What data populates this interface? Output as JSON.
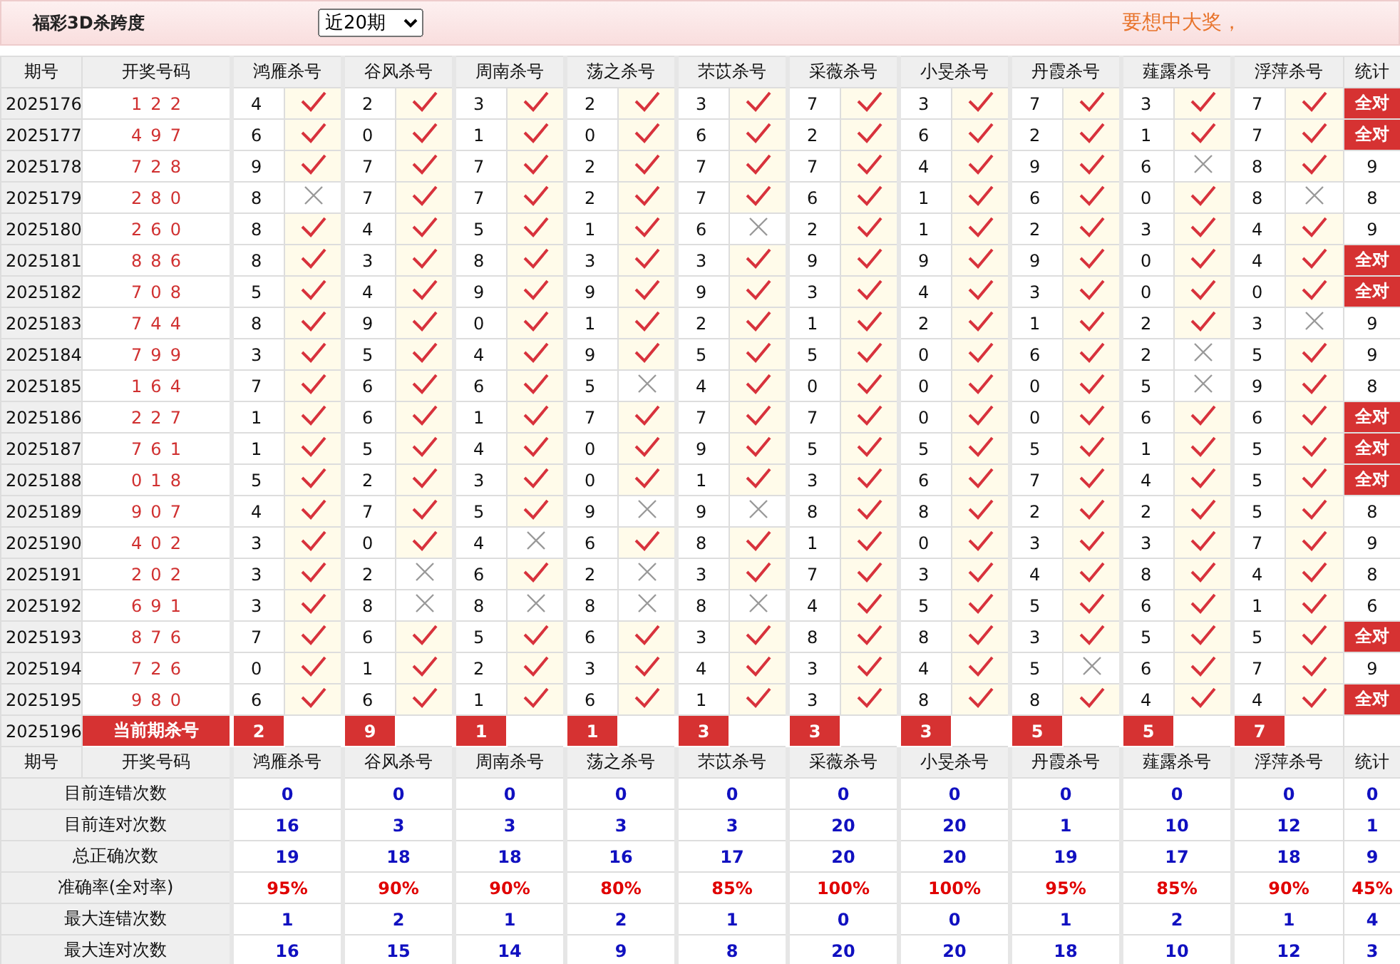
{
  "header": {
    "title": "福彩3D杀跨度",
    "period_select": "近20期",
    "slogan": "要想中大奖，"
  },
  "columns": {
    "period": "期号",
    "draw": "开奖号码",
    "predictors": [
      "鸿雁杀号",
      "谷风杀号",
      "周南杀号",
      "荡之杀号",
      "芣苡杀号",
      "采薇杀号",
      "小旻杀号",
      "丹霞杀号",
      "薤露杀号",
      "浮萍杀号"
    ],
    "stat": "统计"
  },
  "rows": [
    {
      "period": "2025176",
      "draw": "122",
      "picks": [
        "4",
        "2",
        "3",
        "2",
        "3",
        "7",
        "3",
        "7",
        "3",
        "7"
      ],
      "hits": [
        true,
        true,
        true,
        true,
        true,
        true,
        true,
        true,
        true,
        true
      ],
      "stat": "全对",
      "all_correct": true
    },
    {
      "period": "2025177",
      "draw": "497",
      "picks": [
        "6",
        "0",
        "1",
        "0",
        "6",
        "2",
        "6",
        "2",
        "1",
        "7"
      ],
      "hits": [
        true,
        true,
        true,
        true,
        true,
        true,
        true,
        true,
        true,
        true
      ],
      "stat": "全对",
      "all_correct": true
    },
    {
      "period": "2025178",
      "draw": "728",
      "picks": [
        "9",
        "7",
        "7",
        "2",
        "7",
        "7",
        "4",
        "9",
        "6",
        "8"
      ],
      "hits": [
        true,
        true,
        true,
        true,
        true,
        true,
        true,
        true,
        false,
        true
      ],
      "stat": "9",
      "all_correct": false
    },
    {
      "period": "2025179",
      "draw": "280",
      "picks": [
        "8",
        "7",
        "7",
        "2",
        "7",
        "6",
        "1",
        "6",
        "0",
        "8"
      ],
      "hits": [
        false,
        true,
        true,
        true,
        true,
        true,
        true,
        true,
        true,
        false
      ],
      "stat": "8",
      "all_correct": false
    },
    {
      "period": "2025180",
      "draw": "260",
      "picks": [
        "8",
        "4",
        "5",
        "1",
        "6",
        "2",
        "1",
        "2",
        "3",
        "4"
      ],
      "hits": [
        true,
        true,
        true,
        true,
        false,
        true,
        true,
        true,
        true,
        true
      ],
      "stat": "9",
      "all_correct": false
    },
    {
      "period": "2025181",
      "draw": "886",
      "picks": [
        "8",
        "3",
        "8",
        "3",
        "3",
        "9",
        "9",
        "9",
        "0",
        "4"
      ],
      "hits": [
        true,
        true,
        true,
        true,
        true,
        true,
        true,
        true,
        true,
        true
      ],
      "stat": "全对",
      "all_correct": true
    },
    {
      "period": "2025182",
      "draw": "708",
      "picks": [
        "5",
        "4",
        "9",
        "9",
        "9",
        "3",
        "4",
        "3",
        "0",
        "0"
      ],
      "hits": [
        true,
        true,
        true,
        true,
        true,
        true,
        true,
        true,
        true,
        true
      ],
      "stat": "全对",
      "all_correct": true
    },
    {
      "period": "2025183",
      "draw": "744",
      "picks": [
        "8",
        "9",
        "0",
        "1",
        "2",
        "1",
        "2",
        "1",
        "2",
        "3"
      ],
      "hits": [
        true,
        true,
        true,
        true,
        true,
        true,
        true,
        true,
        true,
        false
      ],
      "stat": "9",
      "all_correct": false
    },
    {
      "period": "2025184",
      "draw": "799",
      "picks": [
        "3",
        "5",
        "4",
        "9",
        "5",
        "5",
        "0",
        "6",
        "2",
        "5"
      ],
      "hits": [
        true,
        true,
        true,
        true,
        true,
        true,
        true,
        true,
        false,
        true
      ],
      "stat": "9",
      "all_correct": false
    },
    {
      "period": "2025185",
      "draw": "164",
      "picks": [
        "7",
        "6",
        "6",
        "5",
        "4",
        "0",
        "0",
        "0",
        "5",
        "9"
      ],
      "hits": [
        true,
        true,
        true,
        false,
        true,
        true,
        true,
        true,
        false,
        true
      ],
      "stat": "8",
      "all_correct": false
    },
    {
      "period": "2025186",
      "draw": "227",
      "picks": [
        "1",
        "6",
        "1",
        "7",
        "7",
        "7",
        "0",
        "0",
        "6",
        "6"
      ],
      "hits": [
        true,
        true,
        true,
        true,
        true,
        true,
        true,
        true,
        true,
        true
      ],
      "stat": "全对",
      "all_correct": true
    },
    {
      "period": "2025187",
      "draw": "761",
      "picks": [
        "1",
        "5",
        "4",
        "0",
        "9",
        "5",
        "5",
        "5",
        "1",
        "5"
      ],
      "hits": [
        true,
        true,
        true,
        true,
        true,
        true,
        true,
        true,
        true,
        true
      ],
      "stat": "全对",
      "all_correct": true
    },
    {
      "period": "2025188",
      "draw": "018",
      "picks": [
        "5",
        "2",
        "3",
        "0",
        "1",
        "3",
        "6",
        "7",
        "4",
        "5"
      ],
      "hits": [
        true,
        true,
        true,
        true,
        true,
        true,
        true,
        true,
        true,
        true
      ],
      "stat": "全对",
      "all_correct": true
    },
    {
      "period": "2025189",
      "draw": "907",
      "picks": [
        "4",
        "7",
        "5",
        "9",
        "9",
        "8",
        "8",
        "2",
        "2",
        "5"
      ],
      "hits": [
        true,
        true,
        true,
        false,
        false,
        true,
        true,
        true,
        true,
        true
      ],
      "stat": "8",
      "all_correct": false
    },
    {
      "period": "2025190",
      "draw": "402",
      "picks": [
        "3",
        "0",
        "4",
        "6",
        "8",
        "1",
        "0",
        "3",
        "3",
        "7"
      ],
      "hits": [
        true,
        true,
        false,
        true,
        true,
        true,
        true,
        true,
        true,
        true
      ],
      "stat": "9",
      "all_correct": false
    },
    {
      "period": "2025191",
      "draw": "202",
      "picks": [
        "3",
        "2",
        "6",
        "2",
        "3",
        "7",
        "3",
        "4",
        "8",
        "4"
      ],
      "hits": [
        true,
        false,
        true,
        false,
        true,
        true,
        true,
        true,
        true,
        true
      ],
      "stat": "8",
      "all_correct": false
    },
    {
      "period": "2025192",
      "draw": "691",
      "picks": [
        "3",
        "8",
        "8",
        "8",
        "8",
        "4",
        "5",
        "5",
        "6",
        "1"
      ],
      "hits": [
        true,
        false,
        false,
        false,
        false,
        true,
        true,
        true,
        true,
        true
      ],
      "stat": "6",
      "all_correct": false
    },
    {
      "period": "2025193",
      "draw": "876",
      "picks": [
        "7",
        "6",
        "5",
        "6",
        "3",
        "8",
        "8",
        "3",
        "5",
        "5"
      ],
      "hits": [
        true,
        true,
        true,
        true,
        true,
        true,
        true,
        true,
        true,
        true
      ],
      "stat": "全对",
      "all_correct": true
    },
    {
      "period": "2025194",
      "draw": "726",
      "picks": [
        "0",
        "1",
        "2",
        "3",
        "4",
        "3",
        "4",
        "5",
        "6",
        "7"
      ],
      "hits": [
        true,
        true,
        true,
        true,
        true,
        true,
        true,
        false,
        true,
        true
      ],
      "stat": "9",
      "all_correct": false
    },
    {
      "period": "2025195",
      "draw": "980",
      "picks": [
        "6",
        "6",
        "1",
        "6",
        "1",
        "3",
        "8",
        "8",
        "4",
        "4"
      ],
      "hits": [
        true,
        true,
        true,
        true,
        true,
        true,
        true,
        true,
        true,
        true
      ],
      "stat": "全对",
      "all_correct": true
    }
  ],
  "current": {
    "period": "2025196",
    "label": "当前期杀号",
    "picks": [
      "2",
      "9",
      "1",
      "1",
      "3",
      "3",
      "3",
      "5",
      "5",
      "7"
    ]
  },
  "footer_columns": {
    "period": "期号",
    "draw": "开奖号码",
    "predictors": [
      "鸿雁杀号",
      "谷风杀号",
      "周南杀号",
      "荡之杀号",
      "芣苡杀号",
      "采薇杀号",
      "小旻杀号",
      "丹霞杀号",
      "薤露杀号",
      "浮萍杀号"
    ],
    "stat": "统计"
  },
  "stats": [
    {
      "label": "目前连错次数",
      "kind": "count",
      "values": [
        "0",
        "0",
        "0",
        "0",
        "0",
        "0",
        "0",
        "0",
        "0",
        "0",
        "0"
      ]
    },
    {
      "label": "目前连对次数",
      "kind": "count",
      "values": [
        "16",
        "3",
        "3",
        "3",
        "3",
        "20",
        "20",
        "1",
        "10",
        "12",
        "1"
      ]
    },
    {
      "label": "总正确次数",
      "kind": "count",
      "values": [
        "19",
        "18",
        "18",
        "16",
        "17",
        "20",
        "20",
        "19",
        "17",
        "18",
        "9"
      ]
    },
    {
      "label": "准确率(全对率)",
      "kind": "rate",
      "values": [
        "95%",
        "90%",
        "90%",
        "80%",
        "85%",
        "100%",
        "100%",
        "95%",
        "85%",
        "90%",
        "45%"
      ]
    },
    {
      "label": "最大连错次数",
      "kind": "count",
      "values": [
        "1",
        "2",
        "1",
        "2",
        "1",
        "0",
        "0",
        "1",
        "2",
        "1",
        "4"
      ]
    },
    {
      "label": "最大连对次数",
      "kind": "count",
      "values": [
        "16",
        "15",
        "14",
        "9",
        "8",
        "20",
        "20",
        "18",
        "10",
        "12",
        "3"
      ]
    }
  ]
}
